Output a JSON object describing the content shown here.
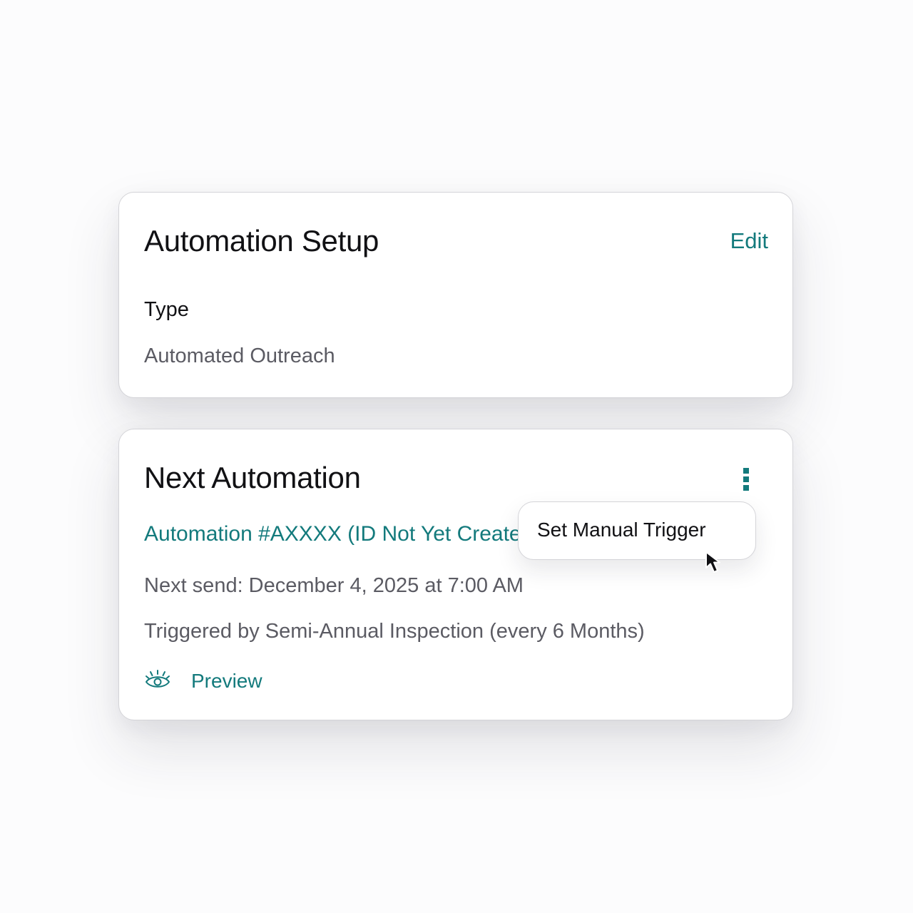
{
  "setup_card": {
    "title": "Automation Setup",
    "edit_label": "Edit",
    "type_label": "Type",
    "type_value": "Automated Outreach"
  },
  "next_card": {
    "title": "Next Automation",
    "automation_link": "Automation #AXXXX (ID Not Yet Created)",
    "next_send": "Next send: December 4, 2025 at 7:00 AM",
    "triggered_by": "Triggered by Semi-Annual Inspection (every 6 Months)",
    "preview_label": "Preview",
    "more_icon": "more-vertical-icon",
    "preview_icon": "eye-icon"
  },
  "context_menu": {
    "items": [
      {
        "label": "Set Manual Trigger"
      }
    ]
  },
  "colors": {
    "accent": "#137a7c",
    "text_primary": "#111114",
    "text_secondary": "#5b5b63",
    "border": "#d4d4d8",
    "background": "#fcfcfd"
  }
}
